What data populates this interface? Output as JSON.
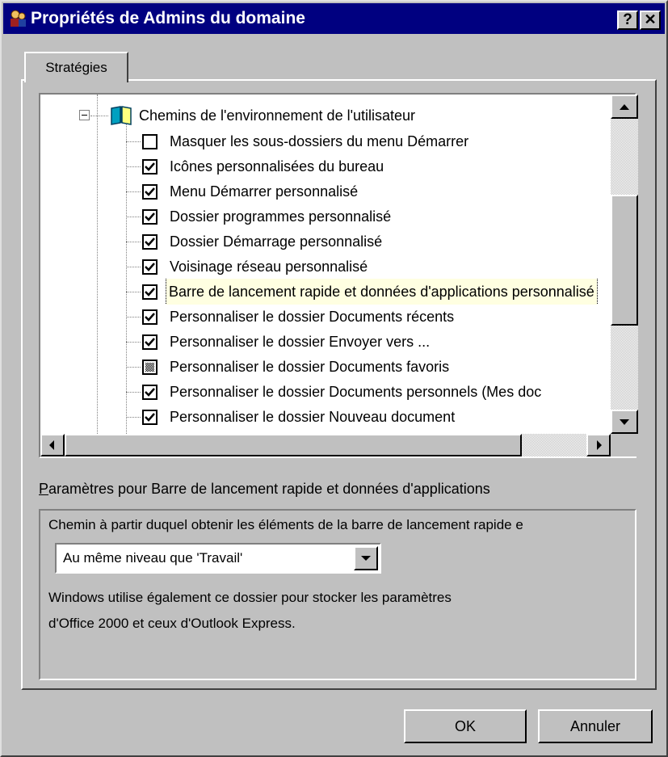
{
  "window": {
    "title": "Propriétés de Admins du domaine",
    "help_button": "?",
    "close_button": "✕"
  },
  "tabs": [
    {
      "label": "Stratégies",
      "active": true
    }
  ],
  "tree": {
    "parent": {
      "label": "Chemins de l'environnement de l'utilisateur",
      "expanded": true,
      "icon": "book-icon"
    },
    "items": [
      {
        "label": "Masquer les sous-dossiers du menu Démarrer",
        "state": "unchecked"
      },
      {
        "label": "Icônes personnalisées du bureau",
        "state": "checked"
      },
      {
        "label": "Menu Démarrer personnalisé",
        "state": "checked"
      },
      {
        "label": "Dossier programmes personnalisé",
        "state": "checked"
      },
      {
        "label": "Dossier Démarrage personnalisé",
        "state": "checked"
      },
      {
        "label": "Voisinage réseau personnalisé",
        "state": "checked"
      },
      {
        "label": "Barre de lancement rapide et données d'applications personnalisé",
        "state": "checked",
        "selected": true
      },
      {
        "label": "Personnaliser le dossier Documents récents",
        "state": "checked"
      },
      {
        "label": "Personnaliser le dossier Envoyer vers ...",
        "state": "checked"
      },
      {
        "label": "Personnaliser le dossier Documents favoris",
        "state": "indeterminate"
      },
      {
        "label": "Personnaliser le dossier Documents personnels (Mes doc",
        "state": "checked"
      },
      {
        "label": "Personnaliser le dossier Nouveau document",
        "state": "checked"
      }
    ]
  },
  "settings": {
    "label": "Paramètres pour Barre de lancement rapide et données d'applications",
    "path_label": "Chemin à partir duquel obtenir les éléments de la barre de lancement rapide e",
    "combo_value": "Au même niveau que 'Travail'",
    "description_line1": "Windows utilise également ce dossier pour stocker les paramètres",
    "description_line2": "d'Office 2000 et ceux d'Outlook Express."
  },
  "buttons": {
    "ok": "OK",
    "cancel": "Annuler"
  },
  "colors": {
    "titlebar": "#000080",
    "face": "#c0c0c0",
    "tooltip": "#ffffe1"
  }
}
